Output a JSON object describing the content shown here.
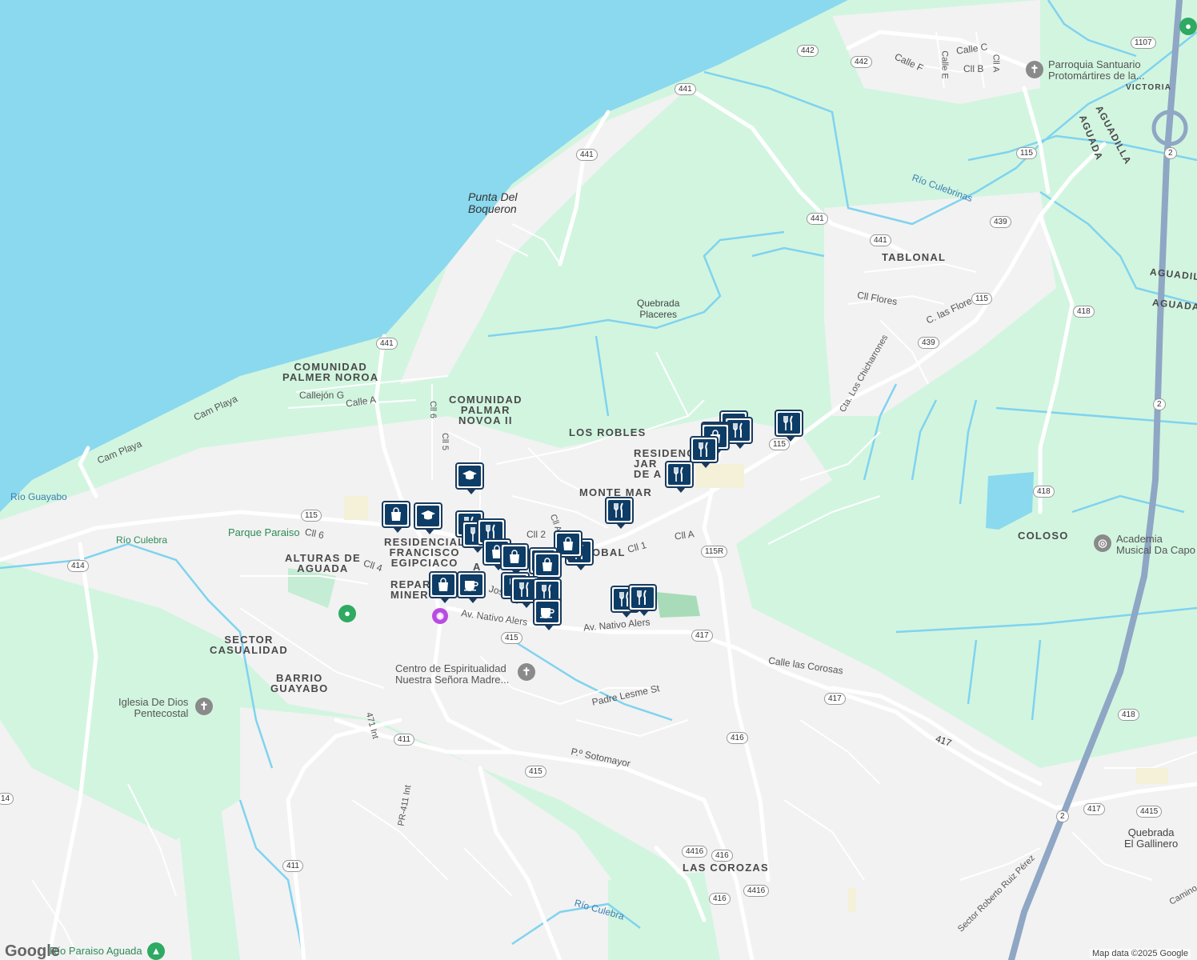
{
  "colors": {
    "water": "#8ad9ee",
    "park": "#d2f5e0",
    "land": "#f2f2f2",
    "road": "#ffffff",
    "highway": "#8fa6c4",
    "river": "#7fd3ef",
    "pin_border": "#1a3a5c",
    "pin_fill": "#0d3c66"
  },
  "area_labels": {
    "palmer_noroa": "COMUNIDAD\nPALMER NOROA",
    "palmar_novoa": "COMUNIDAD\nPALMAR\nNOVOA II",
    "los_robles": "LOS ROBLES",
    "residencial_jardines": "RESIDENC\nJAR\nDE A  DA",
    "monte_mar": "MONTE MAR",
    "tablonal": "TABLONAL",
    "residencial_francisco": "RESIDENCIAL\nFRANCISCO\nEGIPCIACO",
    "alturas": "ALTURAS DE\nAGUADA",
    "reparto": "REPAR\nMINER",
    "sector_casualidad": "SECTOR\nCASUALIDAD",
    "barrio_guayabo": "BARRIO\nGUAYABO",
    "las_corozas": "LAS COROZAS",
    "coloso": "COLOSO",
    "victoria": "VICTORIA",
    "aguadilla": "AGUADILLA",
    "aguada": "AGUADA",
    "aguadill_right": "AGUADIL",
    "aguada_right": "AGUADA",
    "a_downtown": "A",
    "obal": "OBAL"
  },
  "place_labels": {
    "punta_del_boqueron": "Punta Del\nBoqueron",
    "quebrada_placeres": "Quebrada\nPlaceres",
    "quebrada_gallinero": "Quebrada\nEl Gallinero"
  },
  "water_labels": {
    "rio_guayabo": "Río Guayabo",
    "rio_culebra_left": "Río Culebra",
    "rio_culebrinas": "Río Culebrinas",
    "rio_culebra_bottom": "Río Culebra"
  },
  "poi": {
    "parroquia": "Parroquia Santuario\nProtomártires de la...",
    "academia": "Academia\nMusical Da Capo",
    "centro": "Centro de Espiritualidad\nNuestra Señora Madre...",
    "iglesia": "Iglesia De Dios\nPentecostal",
    "parque_paraiso": "Parque Paraiso",
    "rio_paraiso": "Río Paraiso Aguada"
  },
  "street_labels": {
    "calle_c": "Calle C",
    "calle_f": "Calle F",
    "calle_e": "Calle E",
    "cll_b": "Cll B",
    "cll_a_top": "Cll A",
    "cll_flores": "Cll Flores",
    "c_las_flores": "C. las Flores",
    "cta_chicharrones": "Cta. Los Chicharrones",
    "callejon_g": "Callejón G",
    "calle_a": "Calle A",
    "cam_playa_1": "Cam Playa",
    "cam_playa_2": "Cam Playa",
    "cll6_a": "Cll 6",
    "cll5": "Cll 5",
    "cll6_b": "Cll 6",
    "cll4": "Cll 4",
    "cll2": "Cll 2",
    "cll_a_mid": "Cll A",
    "cll1": "Cll 1",
    "cll_a_right": "Cll A",
    "jos": "Jos",
    "nativo_1": "Av. Nativo Alers",
    "nativo_2": "Av. Nativo Alers",
    "padre_lesme": "Padre Lesme St",
    "sotomayor": "P.º Sotomayor",
    "calle_corosas": "Calle las Corosas",
    "int471": "471 Int",
    "pr411": "PR-411 Int",
    "ruiz_perez": "Sector Roberto Ruiz Pérez",
    "camino": "Camino"
  },
  "shields": [
    "442",
    "442",
    "1107",
    "441",
    "441",
    "441",
    "439",
    "441",
    "115",
    "439",
    "441",
    "418",
    "115",
    "2",
    "418",
    "115",
    "115",
    "115R",
    "414",
    "415",
    "417",
    "417",
    "416",
    "411",
    "415",
    "417",
    "4416",
    "416",
    "4416",
    "416",
    "411",
    "2",
    "417",
    "4415",
    "418",
    "2",
    "14"
  ],
  "markers": [
    {
      "type": "shopping"
    },
    {
      "type": "restaurant"
    },
    {
      "type": "restaurant"
    },
    {
      "type": "shopping"
    },
    {
      "type": "restaurant"
    },
    {
      "type": "restaurant"
    },
    {
      "type": "restaurant"
    },
    {
      "type": "school"
    },
    {
      "type": "shopping"
    },
    {
      "type": "school"
    },
    {
      "type": "restaurant"
    },
    {
      "type": "restaurant"
    },
    {
      "type": "restaurant"
    },
    {
      "type": "shopping"
    },
    {
      "type": "shopping"
    },
    {
      "type": "restaurant"
    },
    {
      "type": "shopping"
    },
    {
      "type": "shopping"
    },
    {
      "type": "shopping"
    },
    {
      "type": "restaurant"
    },
    {
      "type": "shopping"
    },
    {
      "type": "cafe"
    },
    {
      "type": "restaurant"
    },
    {
      "type": "restaurant"
    },
    {
      "type": "restaurant"
    },
    {
      "type": "restaurant"
    },
    {
      "type": "cafe"
    },
    {
      "type": "restaurant"
    }
  ],
  "footer": {
    "logo": "Google",
    "map_data": "Map data ©2025 Google"
  }
}
